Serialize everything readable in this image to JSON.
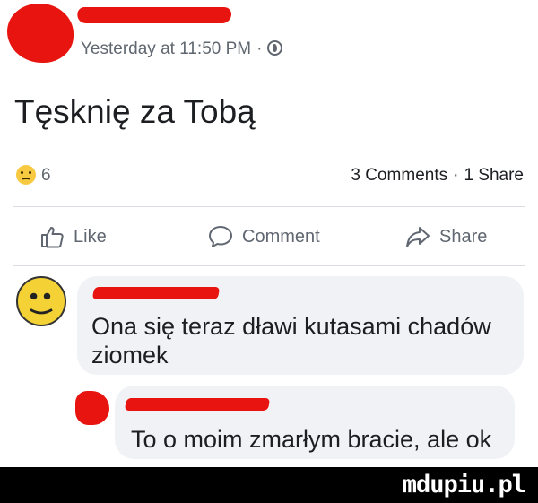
{
  "post": {
    "timestamp": "Yesterday at 11:50 PM",
    "separator": "·",
    "privacy_icon": "globe-icon",
    "text": "Tęsknię za Tobą",
    "reaction_icon": "sad-face-icon",
    "reaction_count": "6",
    "comments_count": "3 Comments",
    "shares_count": "1 Share"
  },
  "actions": {
    "like_label": "Like",
    "comment_label": "Comment",
    "share_label": "Share"
  },
  "comments": [
    {
      "text_line1": "Ona się teraz dławi kutasami chadów",
      "text_line2": "ziomek"
    },
    {
      "text_line1": "To o moim zmarłym bracie, ale ok"
    }
  ],
  "watermark": "mdupiu.pl",
  "colors": {
    "redaction": "#e8140f",
    "bubble": "#f0f2f5",
    "secondary_text": "#606770"
  }
}
